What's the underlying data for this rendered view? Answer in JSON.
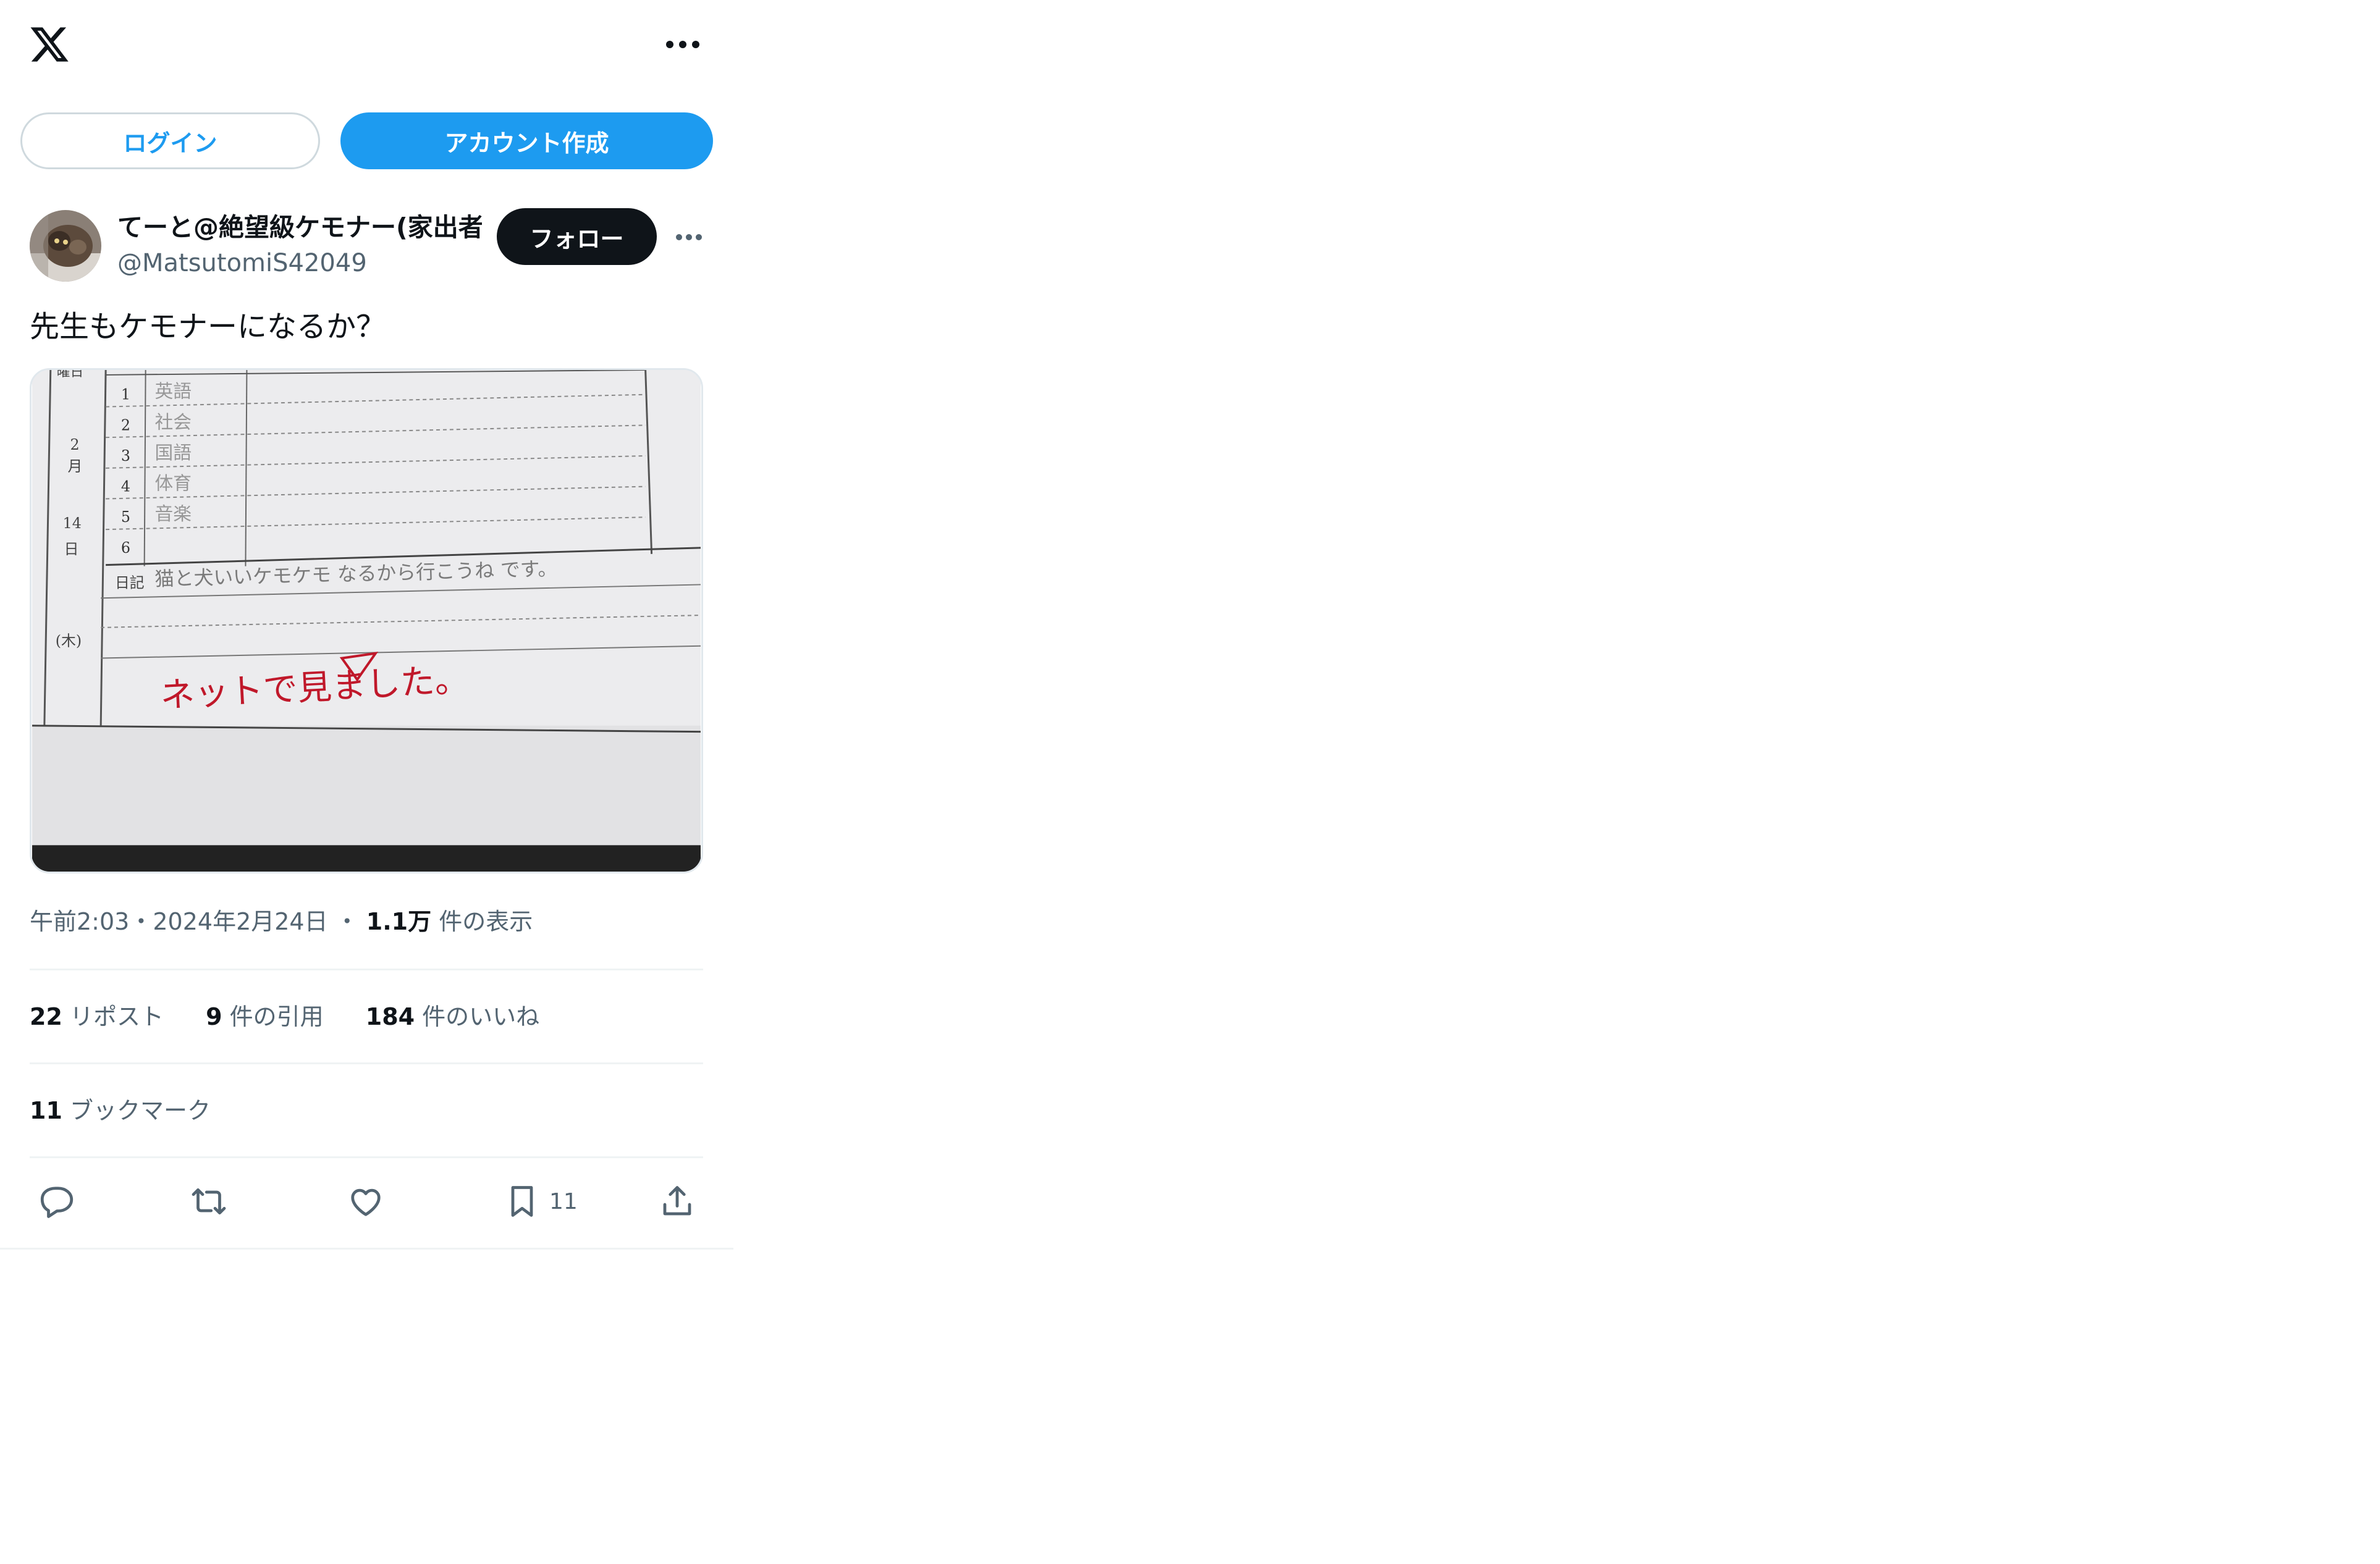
{
  "header": {
    "logo_icon": "x-logo-icon",
    "more_icon": "more-horizontal-icon"
  },
  "auth": {
    "login_label": "ログイン",
    "signup_label": "アカウント作成"
  },
  "tweet": {
    "author": {
      "display_name": "てーと@絶望級ケモナー(家出者",
      "handle": "@MatsutomiS42049",
      "avatar_icon": "avatar-cat-photo"
    },
    "follow_label": "フォロー",
    "text": "先生もケモナーになるか？",
    "meta": {
      "time": "午前2:03",
      "date": "2024年2月24日",
      "views_count": "1.1万",
      "views_label": "件の表示"
    },
    "stats": {
      "reposts_count": "22",
      "reposts_label": "リポスト",
      "quotes_count": "9",
      "quotes_label": "件の引用",
      "likes_count": "184",
      "likes_label": "件のいいね"
    },
    "bookmarks": {
      "count": "11",
      "label": "ブックマーク"
    },
    "actions": {
      "reply_icon": "reply-icon",
      "retweet_icon": "retweet-icon",
      "like_icon": "heart-icon",
      "bookmark_icon": "bookmark-icon",
      "bookmark_count": "11",
      "share_icon": "share-icon"
    }
  },
  "photo": {
    "table_rows": [
      "1",
      "2",
      "3",
      "4",
      "5",
      "6"
    ],
    "side_labels": [
      "2",
      "月",
      "14",
      "日",
      "(木)"
    ],
    "header_label": "曜日",
    "diary_label": "日記",
    "diary_handwriting": "猫と犬いいケモケモ なるから行こうね です。",
    "subject_handwriting": [
      "英語",
      "社会",
      "国語",
      "体育",
      "音楽"
    ],
    "teacher_note": "ネットで見ました。"
  },
  "colors": {
    "accent": "#1d9bf0",
    "ink": "#0f1419",
    "muted": "#536471",
    "red_pen": "#c0182a"
  }
}
